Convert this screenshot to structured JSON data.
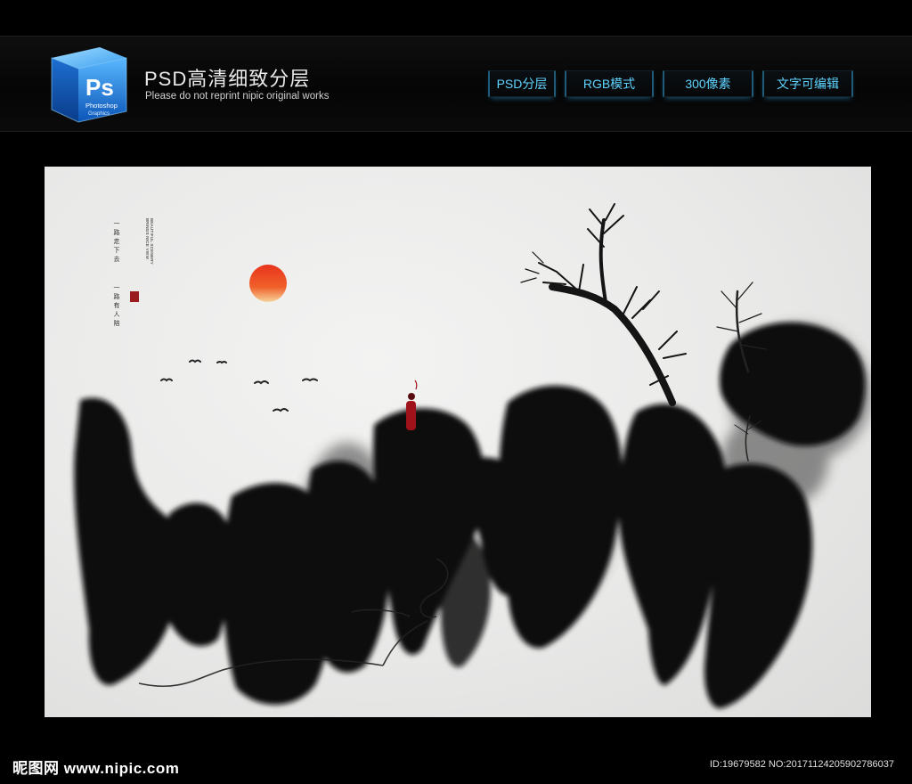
{
  "header": {
    "title": "PSD高清细致分层",
    "subtitle": "Please do not reprint nipic original works",
    "logo": {
      "letters": "Ps",
      "line1": "Photoshop",
      "line2": "Graphics",
      "color": "#1a7fd8"
    },
    "tags": [
      {
        "label": "PSD分层"
      },
      {
        "label": "RGB模式"
      },
      {
        "label": "300像素"
      },
      {
        "label": "文字可编辑"
      }
    ],
    "tag_color": "#5fd4ff"
  },
  "artwork": {
    "vertical_text_1": "一路走下去",
    "vertical_text_2": "一路有人陪",
    "vertical_text_en": "BEAUTIFUL SCENERY BRINGS NICE VIEW",
    "sun_color": "#e8341c",
    "figure_color": "#a0121a"
  },
  "footer": {
    "logo_text": "昵图网 www.nipic.com",
    "id_text": "ID:19679582 NO:20171124205902786037"
  }
}
